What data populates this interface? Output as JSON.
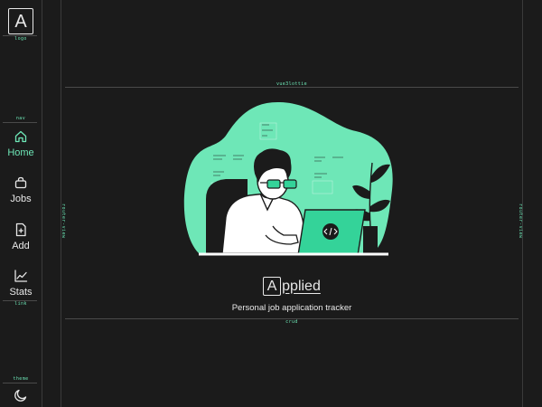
{
  "sidebar": {
    "logo_letter": "A",
    "logo_caption": "logo",
    "nav_caption": "nav",
    "link_caption": "link",
    "theme_caption": "theme",
    "items": [
      {
        "label": "Home",
        "icon": "home-icon",
        "active": true
      },
      {
        "label": "Jobs",
        "icon": "briefcase-icon",
        "active": false
      },
      {
        "label": "Add",
        "icon": "add-file-icon",
        "active": false
      },
      {
        "label": "Stats",
        "icon": "chart-icon",
        "active": false
      }
    ],
    "theme_icon": "moon-icon"
  },
  "frame": {
    "top_caption": "vue3lottie",
    "bottom_caption": "crud",
    "left_caption": "router-view",
    "right_caption": "router-view"
  },
  "brand": {
    "letter": "A",
    "rest": "pplied",
    "tagline": "Personal job application tracker"
  },
  "colors": {
    "accent": "#6ee7b7",
    "background": "#1b1b1b",
    "text": "#e8e8e8"
  }
}
